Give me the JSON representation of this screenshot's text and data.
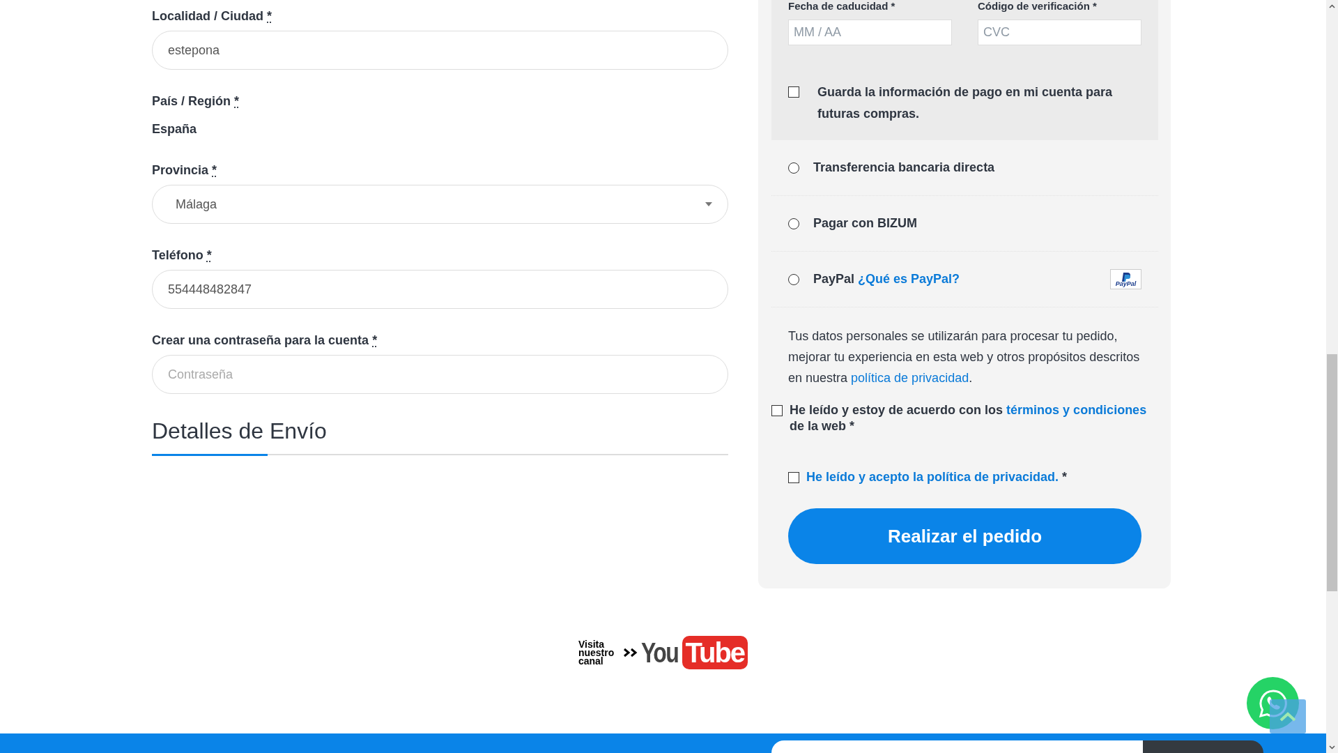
{
  "billing_fields": [
    {
      "kind": "input",
      "label": "Localidad / Ciudad",
      "required_mark": "*",
      "value": "estepona"
    },
    {
      "kind": "static",
      "label": "País / Región",
      "required_mark": "*",
      "value": "España"
    },
    {
      "kind": "select",
      "label": "Provincia",
      "required_mark": "*",
      "value": "Málaga"
    },
    {
      "kind": "input",
      "label": "Teléfono",
      "required_mark": "*",
      "value": "554448482847"
    },
    {
      "kind": "input",
      "label": "Crear una contraseña para la cuenta",
      "required_mark": "*",
      "placeholder": "Contraseña"
    }
  ],
  "shipping_heading": "Detalles de Envío",
  "card_form": {
    "fields": [
      {
        "label": "Fecha de caducidad *",
        "placeholder": "MM / AA"
      },
      {
        "label": "Código de verificación *",
        "placeholder": "CVC"
      }
    ],
    "save_info": {
      "label": "Guarda la información de pago en mi cuenta para futuras compras.",
      "checked": false
    }
  },
  "payment_methods": [
    {
      "label": "Transferencia bancaria directa",
      "selected": false
    },
    {
      "label": "Pagar con BIZUM",
      "selected": false
    },
    {
      "label": "PayPal",
      "link": "¿Qué es PayPal?",
      "logo_text": "PayPal",
      "selected": false
    }
  ],
  "privacy_notice": {
    "text": "Tus datos personales se utilizarán para procesar tu pedido, mejorar tu experiencia en esta web y otros propósitos descritos en nuestra",
    "link": "política de privacidad",
    "end": "."
  },
  "agreements": [
    {
      "kind": "terms",
      "text": "He leído y estoy de acuerdo con los",
      "link": "términos y condiciones",
      "after": "de la web *",
      "checked": false
    },
    {
      "kind": "privacy",
      "link": "He leído y acepto la política de privacidad.",
      "after": "*",
      "checked": false
    }
  ],
  "place_order_button": "Realizar el pedido",
  "youtube_banner": {
    "caption": "Visita nuestro canal",
    "brand_left": "You",
    "brand_right": "Tube"
  }
}
